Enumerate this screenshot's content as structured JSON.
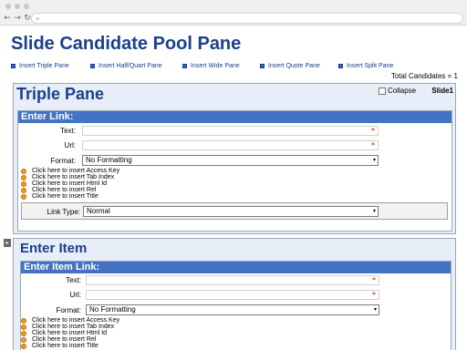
{
  "browser": {
    "nav": {
      "back": "←",
      "forward": "→",
      "reload": "↻"
    },
    "search_icon": "⌕"
  },
  "page": {
    "title": "Slide Candidate Pool Pane",
    "actions": [
      {
        "label": "Insert Triple Pane"
      },
      {
        "label": "Insert Half/Quart Pane"
      },
      {
        "label": "Insert Wide Pane"
      },
      {
        "label": "Insert Quote Pane"
      },
      {
        "label": "Insert Split Pane"
      }
    ],
    "total_candidates": "Total Candidates = 1"
  },
  "triple_pane": {
    "title": "Triple Pane",
    "collapse_label": "Collapse",
    "slide_label": "Slide1",
    "link_section": {
      "header": "Enter Link:",
      "text_label": "Text:",
      "url_label": "Url:",
      "format_label": "Format:",
      "format_value": "No Formatting",
      "required_marker": "*",
      "links": [
        "Click here to insert Access Key",
        "Click here to insert Tab Index",
        "Click here to insert Html Id",
        "Click here to insert Rel",
        "Click here to insert Title"
      ],
      "link_type_label": "Link Type:",
      "link_type_value": "Normal"
    }
  },
  "item_pane": {
    "expander": "▸",
    "title": "Enter Item",
    "link_section": {
      "header": "Enter Item Link:",
      "text_label": "Text:",
      "url_label": "Url:",
      "format_label": "Format:",
      "format_value": "No Formatting",
      "required_marker": "*",
      "links": [
        "Click here to insert Access Key",
        "Click here to insert Tab Index",
        "Click here to insert Html Id",
        "Click here to insert Rel",
        "Click here to insert Title"
      ]
    }
  },
  "colors": {
    "title_blue": "#1b3f8b",
    "header_blue": "#4472c4",
    "pane_bg": "#e8eef8",
    "required_orange": "#e05a1a",
    "bullet_orange": "#f0a020"
  },
  "icons": {
    "dropdown": "▾"
  }
}
